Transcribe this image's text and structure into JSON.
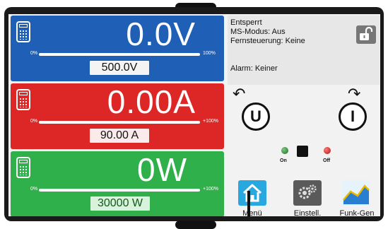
{
  "voltage": {
    "value": "0.0V",
    "min_label": "0%",
    "max_label": "100%",
    "set_value": "500.0V",
    "level_fraction": 0
  },
  "current": {
    "value": "0.00A",
    "min_label": "0%",
    "max_label": "+100%",
    "set_value": "90.00 A",
    "level_fraction": 0
  },
  "power": {
    "value": "0W",
    "min_label": "0%",
    "max_label": "+100%",
    "set_value": "30000 W",
    "level_fraction": 0
  },
  "status": {
    "lock_state": "Entsperrt",
    "ms_mode": "MS-Modus: Aus",
    "remote": "Fernsteuerung: Keine",
    "alarm": "Alarm: Keiner"
  },
  "knobs": {
    "left_label": "U",
    "right_label": "I"
  },
  "output": {
    "on_label": "On",
    "off_label": "Off"
  },
  "bottom_menu": {
    "menu_label": "Menü",
    "settings_label": "Einstell.",
    "function_gen_label": "Funk-Gen"
  },
  "colors": {
    "voltage": "#1f5fb5",
    "current": "#dd2626",
    "power": "#2fb04a",
    "menu_tile": "#29a8e0"
  },
  "icons": {
    "panel_icon": "calculator-icon",
    "lock": "unlocked-padlock-icon",
    "menu": "home-icon",
    "settings": "gears-icon",
    "function_gen": "waveform-icon"
  }
}
